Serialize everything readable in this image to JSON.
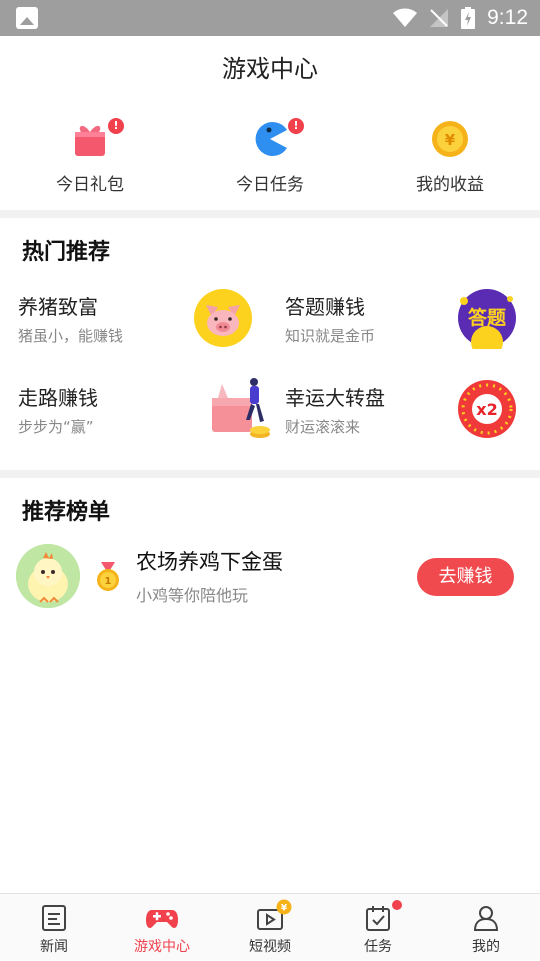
{
  "status_bar": {
    "time": "9:12"
  },
  "header": {
    "title": "游戏中心"
  },
  "quick_actions": [
    {
      "label": "今日礼包",
      "icon": "gift-icon"
    },
    {
      "label": "今日任务",
      "icon": "pacman-icon"
    },
    {
      "label": "我的收益",
      "icon": "coin-icon",
      "coin_symbol": "¥"
    }
  ],
  "hot": {
    "title": "热门推荐",
    "items": [
      {
        "name": "养猪致富",
        "desc": "猪虽小，能赚钱",
        "icon": "pig-icon"
      },
      {
        "name": "答题赚钱",
        "desc": "知识就是金币",
        "icon": "quiz-icon",
        "badge_text": "答题"
      },
      {
        "name": "走路赚钱",
        "desc": "步步为“赢”",
        "icon": "walking-icon"
      },
      {
        "name": "幸运大转盘",
        "desc": "财运滚滚来",
        "icon": "wheel-icon",
        "badge_text": "x2"
      }
    ]
  },
  "ranking": {
    "title": "推荐榜单",
    "items": [
      {
        "rank": "1",
        "title": "农场养鸡下金蛋",
        "desc": "小鸡等你陪他玩",
        "button": "去赚钱",
        "icon": "chick-icon"
      }
    ]
  },
  "tabbar": {
    "items": [
      {
        "label": "新闻",
        "icon": "news-icon"
      },
      {
        "label": "游戏中心",
        "icon": "gamepad-icon",
        "active": true
      },
      {
        "label": "短视频",
        "icon": "video-icon"
      },
      {
        "label": "任务",
        "icon": "task-icon"
      },
      {
        "label": "我的",
        "icon": "profile-icon"
      }
    ]
  },
  "colors": {
    "accent": "#f0414c",
    "status_bar": "#9e9e9e",
    "divider": "#f1f1f1"
  }
}
